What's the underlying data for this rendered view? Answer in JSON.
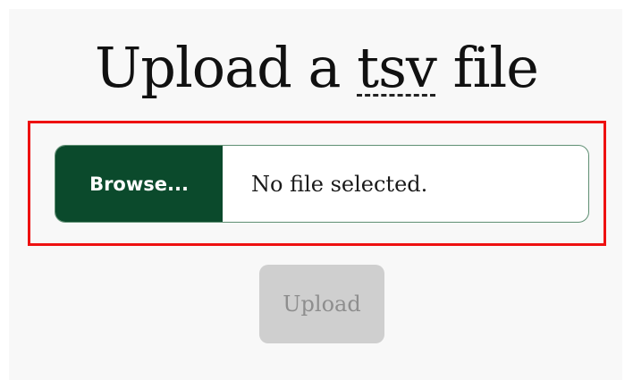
{
  "title": {
    "prefix": "Upload a ",
    "abbr": "tsv",
    "suffix": " file"
  },
  "file_input": {
    "browse_label": "Browse...",
    "status": "No file selected."
  },
  "upload_button": {
    "label": "Upload",
    "disabled": true
  },
  "colors": {
    "browse_bg": "#0b4a2c",
    "highlight_border": "#ee1111",
    "upload_disabled_bg": "#cfcfcf"
  }
}
